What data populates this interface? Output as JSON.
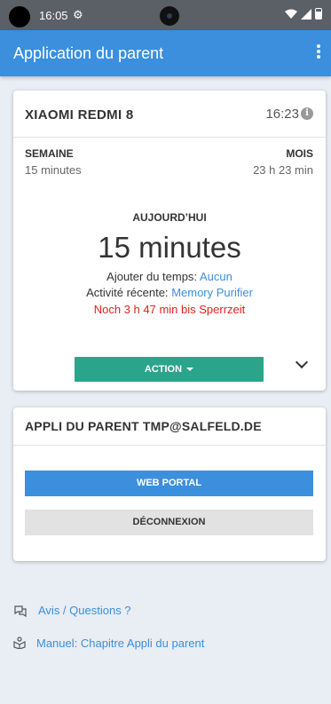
{
  "status_bar": {
    "time": "16:05"
  },
  "app_bar": {
    "title": "Application du parent"
  },
  "device_card": {
    "device_name": "XIAOMI REDMI 8",
    "last_sync": "16:23",
    "week_label": "SEMAINE",
    "week_value": "15 minutes",
    "month_label": "MOIS",
    "month_value": "23 h 23 min",
    "today_label": "AUJOURD’HUI",
    "today_value": "15 minutes",
    "add_time_label": "Ajouter du temps:",
    "add_time_value": "Aucun",
    "recent_activity_label": "Activité récente:",
    "recent_activity_value": "Memory Purifier",
    "lock_notice": "Noch 3 h 47 min bis Sperrzeit",
    "action_label": "ACTION"
  },
  "parent_card": {
    "title": "APPLI DU PARENT TMP@SALFELD.DE",
    "web_portal_label": "WEB PORTAL",
    "logout_label": "DÉCONNEXION"
  },
  "links": [
    {
      "label": "Avis / Questions ?",
      "icon": "chat-icon"
    },
    {
      "label": "Manuel: Chapitre Appli du parent",
      "icon": "book-icon"
    }
  ]
}
